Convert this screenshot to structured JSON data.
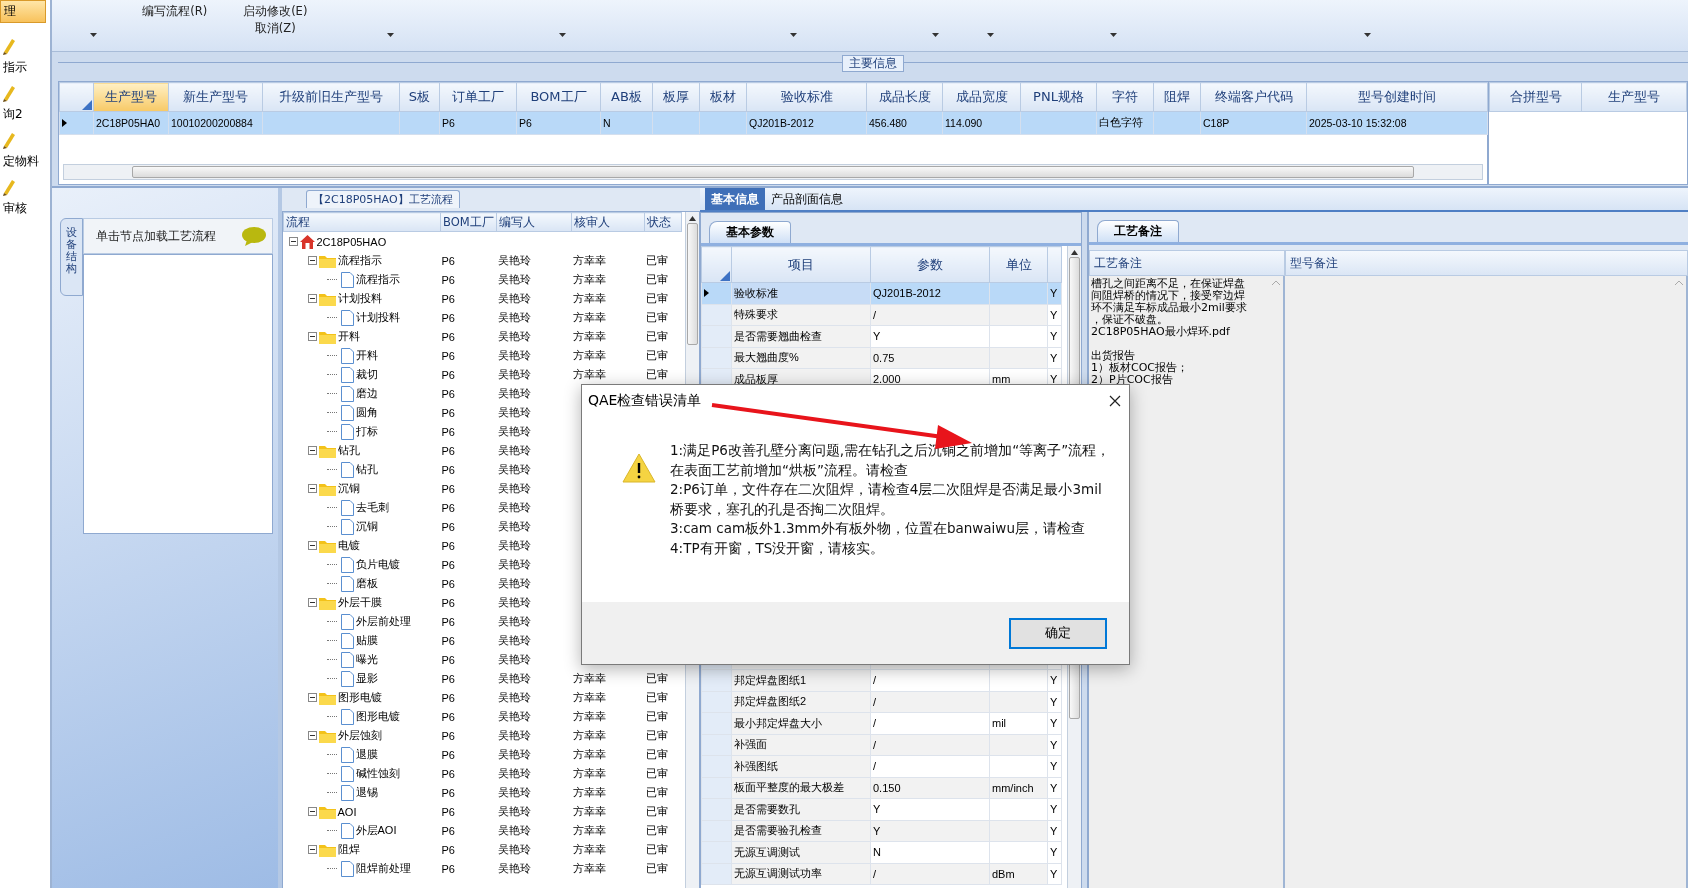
{
  "sidebar": {
    "items": [
      {
        "label": "理",
        "selected": true
      },
      {
        "label": "指示",
        "selected": false
      },
      {
        "label": "询2",
        "selected": false
      },
      {
        "label": "定物料",
        "selected": false
      },
      {
        "label": "审核",
        "selected": false
      }
    ]
  },
  "toolbar": {
    "groups": [
      {
        "dropdown": true
      },
      {
        "labels": [
          "编写流程(R)"
        ]
      },
      {
        "labels": [
          "启动修改(E)",
          "取消(Z)"
        ]
      },
      {
        "dropdown": true
      },
      {
        "dropdown": true
      },
      {
        "dropdown": true
      },
      {
        "dropdown": true
      },
      {
        "dropdown": true
      },
      {
        "dropdown": true
      },
      {
        "dropdown": true
      }
    ]
  },
  "main_info": {
    "title": "主要信息",
    "columns": [
      {
        "label": "生产型号",
        "selected": true
      },
      {
        "label": "新生产型号",
        "selected": false
      },
      {
        "label": "升级前旧生产型号",
        "selected": false
      },
      {
        "label": "S板",
        "selected": false
      },
      {
        "label": "订单工厂",
        "selected": false
      },
      {
        "label": "BOM工厂",
        "selected": false
      },
      {
        "label": "AB板",
        "selected": false
      },
      {
        "label": "板厚",
        "selected": false
      },
      {
        "label": "板材",
        "selected": false
      },
      {
        "label": "验收标准",
        "selected": false
      },
      {
        "label": "成品长度",
        "selected": false
      },
      {
        "label": "成品宽度",
        "selected": false
      },
      {
        "label": "PNL规格",
        "selected": false
      },
      {
        "label": "字符",
        "selected": false
      },
      {
        "label": "阻焊",
        "selected": false
      },
      {
        "label": "终端客户代码",
        "selected": false
      },
      {
        "label": "型号创建时间",
        "selected": false
      }
    ],
    "rows": [
      {
        "selected": true,
        "cells": [
          "2C18P05HA0",
          "10010200200884",
          null,
          null,
          "P6",
          "P6",
          "N",
          null,
          null,
          "QJ201B-2012",
          "456.480",
          "114.090",
          null,
          "白色字符",
          null,
          "C18P",
          "2025-03-10 15:32:08"
        ]
      }
    ],
    "merge_columns": [
      "合拼型号",
      "生产型号"
    ]
  },
  "structure_panel": {
    "tab": "设备结构",
    "hint": "单击节点加载工艺流程"
  },
  "process_tree": {
    "title": "【2C18P05HAO】工艺流程",
    "columns": [
      "流程",
      "BOM工厂",
      "编写人",
      "核审人",
      "状态"
    ],
    "root": {
      "label": "2C18P05HAO",
      "expanded": true,
      "children": [
        {
          "label": "流程指示",
          "expanded": true,
          "factory": "P6",
          "writer": "吴艳玲",
          "reviewer": "方幸幸",
          "status": "已审",
          "children": [
            {
              "label": "流程指示",
              "factory": "P6",
              "writer": "吴艳玲",
              "reviewer": "方幸幸",
              "status": "已审"
            }
          ]
        },
        {
          "label": "计划投料",
          "expanded": true,
          "factory": "P6",
          "writer": "吴艳玲",
          "reviewer": "方幸幸",
          "status": "已审",
          "children": [
            {
              "label": "计划投料",
              "factory": "P6",
              "writer": "吴艳玲",
              "reviewer": "方幸幸",
              "status": "已审"
            }
          ]
        },
        {
          "label": "开料",
          "expanded": true,
          "factory": "P6",
          "writer": "吴艳玲",
          "reviewer": "方幸幸",
          "status": "已审",
          "children": [
            {
              "label": "开料",
              "factory": "P6",
              "writer": "吴艳玲",
              "reviewer": "方幸幸",
              "status": "已审"
            },
            {
              "label": "裁切",
              "factory": "P6",
              "writer": "吴艳玲",
              "reviewer": "方幸幸",
              "status": "已审"
            },
            {
              "label": "磨边",
              "factory": "P6",
              "writer": "吴艳玲"
            },
            {
              "label": "圆角",
              "factory": "P6",
              "writer": "吴艳玲"
            },
            {
              "label": "打标",
              "factory": "P6",
              "writer": "吴艳玲"
            }
          ]
        },
        {
          "label": "钻孔",
          "expanded": true,
          "factory": "P6",
          "writer": "吴艳玲",
          "children": [
            {
              "label": "钻孔",
              "factory": "P6",
              "writer": "吴艳玲"
            }
          ]
        },
        {
          "label": "沉铜",
          "expanded": true,
          "factory": "P6",
          "writer": "吴艳玲",
          "children": [
            {
              "label": "去毛刺",
              "factory": "P6",
              "writer": "吴艳玲"
            },
            {
              "label": "沉铜",
              "factory": "P6",
              "writer": "吴艳玲"
            }
          ]
        },
        {
          "label": "电镀",
          "expanded": true,
          "factory": "P6",
          "writer": "吴艳玲",
          "children": [
            {
              "label": "负片电镀",
              "factory": "P6",
              "writer": "吴艳玲"
            },
            {
              "label": "磨板",
              "factory": "P6",
              "writer": "吴艳玲"
            }
          ]
        },
        {
          "label": "外层干膜",
          "expanded": true,
          "factory": "P6",
          "writer": "吴艳玲",
          "children": [
            {
              "label": "外层前处理",
              "factory": "P6",
              "writer": "吴艳玲"
            },
            {
              "label": "贴膜",
              "factory": "P6",
              "writer": "吴艳玲"
            },
            {
              "label": "曝光",
              "factory": "P6",
              "writer": "吴艳玲"
            },
            {
              "label": "显影",
              "factory": "P6",
              "writer": "吴艳玲",
              "reviewer": "方幸幸",
              "status": "已审"
            }
          ]
        },
        {
          "label": "图形电镀",
          "expanded": true,
          "factory": "P6",
          "writer": "吴艳玲",
          "reviewer": "方幸幸",
          "status": "已审",
          "children": [
            {
              "label": "图形电镀",
              "factory": "P6",
              "writer": "吴艳玲",
              "reviewer": "方幸幸",
              "status": "已审"
            }
          ]
        },
        {
          "label": "外层蚀刻",
          "expanded": true,
          "factory": "P6",
          "writer": "吴艳玲",
          "reviewer": "方幸幸",
          "status": "已审",
          "children": [
            {
              "label": "退膜",
              "factory": "P6",
              "writer": "吴艳玲",
              "reviewer": "方幸幸",
              "status": "已审"
            },
            {
              "label": "碱性蚀刻",
              "factory": "P6",
              "writer": "吴艳玲",
              "reviewer": "方幸幸",
              "status": "已审"
            },
            {
              "label": "退锡",
              "factory": "P6",
              "writer": "吴艳玲",
              "reviewer": "方幸幸",
              "status": "已审"
            }
          ]
        },
        {
          "label": "AOI",
          "expanded": true,
          "factory": "P6",
          "writer": "吴艳玲",
          "reviewer": "方幸幸",
          "status": "已审",
          "children": [
            {
              "label": "外层AOI",
              "factory": "P6",
              "writer": "吴艳玲",
              "reviewer": "方幸幸",
              "status": "已审"
            }
          ]
        },
        {
          "label": "阻焊",
          "expanded": true,
          "factory": "P6",
          "writer": "吴艳玲",
          "reviewer": "方幸幸",
          "status": "已审",
          "children": [
            {
              "label": "阻焊前处理",
              "factory": "P6",
              "writer": "吴艳玲",
              "reviewer": "方幸幸",
              "status": "已审"
            }
          ]
        }
      ]
    }
  },
  "info_tabs": [
    {
      "label": "基本信息",
      "selected": true
    },
    {
      "label": "产品剖面信息",
      "selected": false
    }
  ],
  "param_tabs": [
    {
      "label": "基本参数",
      "selected": true
    }
  ],
  "params": {
    "columns": [
      "项目",
      "参数",
      "单位"
    ],
    "rows_top": [
      {
        "item": "验收标准",
        "value": "QJ201B-2012",
        "flag": "Y",
        "selected": true
      },
      {
        "item": "特殊要求",
        "value": "/",
        "flag": "Y",
        "selected": false
      },
      {
        "item": "是否需要翘曲检查",
        "value": "Y",
        "flag": "Y",
        "selected": false
      },
      {
        "item": "最大翘曲度%",
        "value": "0.75",
        "flag": "Y",
        "selected": false
      },
      {
        "item": "成品板厚",
        "value": "2.000",
        "unit": "mm",
        "flag": "Y",
        "selected": false
      }
    ],
    "rows_bottom": [
      {
        "item": "邦定焊盘图纸1",
        "value": "/",
        "flag": "Y",
        "selected": false
      },
      {
        "item": "邦定焊盘图纸2",
        "value": "/",
        "flag": "Y",
        "selected": false
      },
      {
        "item": "最小邦定焊盘大小",
        "value": "/",
        "unit": "mil",
        "flag": "Y",
        "selected": false
      },
      {
        "item": "补强面",
        "value": "/",
        "flag": "Y",
        "selected": false
      },
      {
        "item": "补强图纸",
        "value": "/",
        "flag": "Y",
        "selected": false
      },
      {
        "item": "板面平整度的最大极差",
        "value": "0.150",
        "unit": "mm/inch",
        "flag": "Y",
        "selected": false
      },
      {
        "item": "是否需要数孔",
        "value": "Y",
        "flag": "Y",
        "selected": false
      },
      {
        "item": "是否需要验孔检查",
        "value": "Y",
        "flag": "Y",
        "selected": false
      },
      {
        "item": "无源互调测试",
        "value": "N",
        "flag": "Y",
        "selected": false
      },
      {
        "item": "无源互调测试功率",
        "value": "/",
        "unit": "dBm",
        "flag": "Y",
        "selected": false
      }
    ]
  },
  "notes": {
    "tab": "工艺备注",
    "columns": [
      "工艺备注",
      "型号备注"
    ],
    "paragraphs": [
      {
        "lines": [
          "槽孔之间距离不足，在保证焊盘",
          "间阻焊桥的情况下，接受窄边焊",
          "环不满足车标成品最小2mil要求",
          "，保证不破盘。",
          "2C18P05HAO最小焊环.pdf"
        ]
      },
      {
        "lines": [
          "出货报告",
          "1）板材COC报告；",
          "2）P片COC报告"
        ]
      }
    ]
  },
  "dialog": {
    "title": "QAE检查错误清单",
    "messages": [
      "1:满足P6改善孔壁分离问题,需在钻孔之后沉铜之前增加“等离子”流程，在表面工艺前增加“烘板”流程。请检查",
      "2:P6订单，文件存在二次阻焊，请检查4层二次阻焊是否满足最小3mil桥要求，塞孔的孔是否掏二次阻焊。",
      "3:cam cam板外1.3mm外有板外物，位置在banwaiwu层，请检查",
      "4:TP有开窗，TS没开窗，请核实。"
    ],
    "ok_button": "确定"
  }
}
